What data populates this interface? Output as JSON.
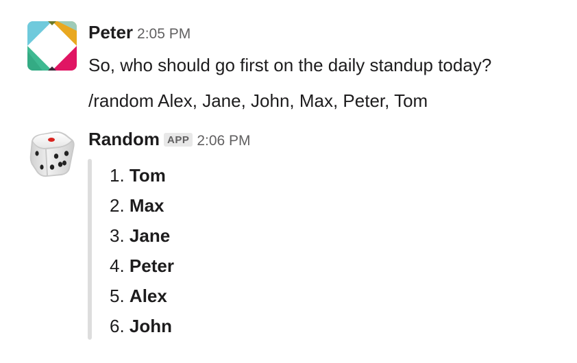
{
  "messages": [
    {
      "sender": "Peter",
      "time": "2:05 PM",
      "avatar_icon": "slack-logo-icon",
      "lines": [
        "So, who should go first on the daily standup today?",
        "/random Alex, Jane, John, Max, Peter, Tom"
      ]
    },
    {
      "sender": "Random",
      "badge": "APP",
      "time": "2:06 PM",
      "avatar_icon": "dice-icon",
      "list": [
        {
          "num": "1.",
          "name": "Tom"
        },
        {
          "num": "2.",
          "name": "Max"
        },
        {
          "num": "3.",
          "name": "Jane"
        },
        {
          "num": "4.",
          "name": "Peter"
        },
        {
          "num": "5.",
          "name": "Alex"
        },
        {
          "num": "6.",
          "name": "John"
        }
      ]
    }
  ],
  "colors": {
    "text": "#1d1c1d",
    "muted": "#616061",
    "badge_bg": "#e8e8e8",
    "attachment_bar": "#dddddd"
  }
}
